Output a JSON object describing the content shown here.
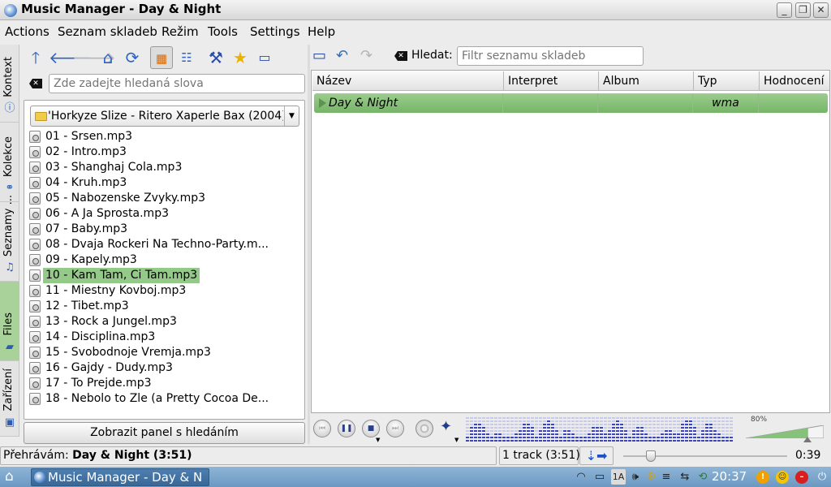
{
  "window": {
    "title": "Music Manager - Day & Night"
  },
  "menu": [
    "Actions",
    "Seznam skladeb",
    "Režim",
    "Tools",
    "Settings",
    "Help"
  ],
  "side_tabs": [
    "Kontext",
    "Kolekce",
    "Seznamy ...",
    "Files",
    "Zařízení"
  ],
  "left_panel": {
    "search_placeholder": "Zde zadejte hledaná slova",
    "path": "'Horkyze Slize - Ritero Xaperle Bax (2004)/",
    "files": [
      "01 - Srsen.mp3",
      "02 - Intro.mp3",
      "03 - Shanghaj Cola.mp3",
      "04 - Kruh.mp3",
      "05 - Nabozenske Zvyky.mp3",
      "06 - A Ja Sprosta.mp3",
      "07 - Baby.mp3",
      "08 - Dvaja Rockeri Na Techno-Party.m...",
      "09 - Kapely.mp3",
      "10 - Kam Tam, Ci Tam.mp3",
      "11 - Miestny Kovboj.mp3",
      "12 - Tibet.mp3",
      "13 - Rock a Jungel.mp3",
      "14 - Disciplina.mp3",
      "15 - Svobodnoje Vremja.mp3",
      "16 - Gajdy - Dudy.mp3",
      "17 - To Prejde.mp3",
      "18 - Nebolo to Zle (a Pretty Cocoa De..."
    ],
    "selected_file": "10 - Kam Tam, Ci Tam.mp3",
    "show_search_button": "Zobrazit panel s hledáním"
  },
  "playlist_toolbar": {
    "search_label": "Hledat:",
    "filter_placeholder": "Filtr seznamu skladeb"
  },
  "playlist": {
    "columns": [
      "Název",
      "Interpret",
      "Album",
      "Typ",
      "Hodnocení"
    ],
    "rows": [
      {
        "title": "Day & Night",
        "artist": "",
        "album": "",
        "type": "wma",
        "rating": ""
      }
    ]
  },
  "player": {
    "volume": "80%",
    "volume_fraction": 0.8,
    "seek_fraction": 0.17
  },
  "status": {
    "playing_label": "Přehrávám:",
    "now_playing": "Day & Night (3:51)",
    "tracks": "1 track (3:51)",
    "elapsed": "0:39"
  },
  "taskbar": {
    "task": "Music Manager - Day & N",
    "clock": "20:37",
    "keyboard": "1A"
  },
  "colors": {
    "selection_green": "#94c98a",
    "playing_row_green": "#8ec47f",
    "taskbar_blue": "#7aa4cc",
    "analyzer_blue": "#3c46b8"
  }
}
